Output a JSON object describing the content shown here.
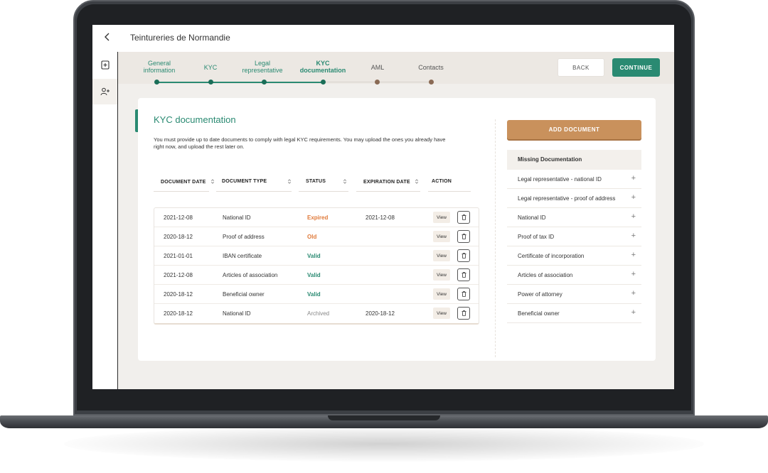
{
  "topbar": {
    "back": "‹",
    "company": "Teintureries de Normandie"
  },
  "sidebar": {
    "items": [
      {
        "icon": "document-plus-icon"
      },
      {
        "icon": "add-user-icon"
      }
    ]
  },
  "stepper": {
    "steps": [
      {
        "label_line1": "General",
        "label_line2": "information",
        "state": "done"
      },
      {
        "label_line1": "KYC",
        "label_line2": "",
        "state": "done"
      },
      {
        "label_line1": "Legal",
        "label_line2": "representative",
        "state": "done"
      },
      {
        "label_line1": "KYC",
        "label_line2": "documentation",
        "state": "current"
      },
      {
        "label_line1": "AML",
        "label_line2": "",
        "state": "todo"
      },
      {
        "label_line1": "Contacts",
        "label_line2": "",
        "state": "todo"
      }
    ],
    "back_label": "BACK",
    "continue_label": "CONTINUE"
  },
  "section": {
    "title": "KYC documentation",
    "description": "You must provide up to date documents to comply with legal KYC requirements. You may upload the ones you already have right now, and upload the rest later on."
  },
  "table": {
    "headers": [
      "DOCUMENT DATE",
      "DOCUMENT TYPE",
      "STATUS",
      "EXPIRATION DATE",
      "ACTION"
    ],
    "view_label": "View",
    "rows": [
      {
        "date": "2021-12-08",
        "type": "National ID",
        "status": "Expired",
        "status_kind": "expired",
        "expiration": "2021-12-08"
      },
      {
        "date": "2020-18-12",
        "type": "Proof of address",
        "status": "Old",
        "status_kind": "old",
        "expiration": ""
      },
      {
        "date": "2021-01-01",
        "type": "IBAN certificate",
        "status": "Valid",
        "status_kind": "valid",
        "expiration": ""
      },
      {
        "date": "2021-12-08",
        "type": "Articles of association",
        "status": "Valid",
        "status_kind": "valid",
        "expiration": ""
      },
      {
        "date": "2020-18-12",
        "type": "Beneficial owner",
        "status": "Valid",
        "status_kind": "valid",
        "expiration": ""
      },
      {
        "date": "2020-18-12",
        "type": "National ID",
        "status": "Archived",
        "status_kind": "archived",
        "expiration": "2020-18-12"
      }
    ]
  },
  "right_panel": {
    "add_label": "ADD DOCUMENT",
    "missing_title": "Missing Documentation",
    "missing_items": [
      "Legal representative - national ID",
      "Legal representative - proof of address",
      "National ID",
      "Proof of tax ID",
      "Certificate of incorporation",
      "Articles of association",
      "Power of attorney",
      "Beneficial owner"
    ],
    "plus": "+"
  },
  "colors": {
    "accent": "#2a8a72",
    "warning": "#e07a3a",
    "add_button": "#c9915c"
  }
}
